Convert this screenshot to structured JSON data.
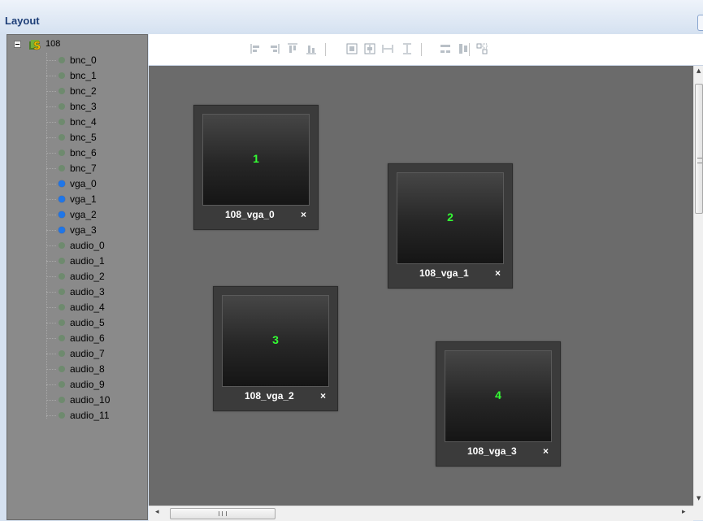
{
  "panel": {
    "title": "Layout"
  },
  "tree": {
    "root_label": "108",
    "items": [
      {
        "label": "bnc_0",
        "active": false
      },
      {
        "label": "bnc_1",
        "active": false
      },
      {
        "label": "bnc_2",
        "active": false
      },
      {
        "label": "bnc_3",
        "active": false
      },
      {
        "label": "bnc_4",
        "active": false
      },
      {
        "label": "bnc_5",
        "active": false
      },
      {
        "label": "bnc_6",
        "active": false
      },
      {
        "label": "bnc_7",
        "active": false
      },
      {
        "label": "vga_0",
        "active": true
      },
      {
        "label": "vga_1",
        "active": true
      },
      {
        "label": "vga_2",
        "active": true
      },
      {
        "label": "vga_3",
        "active": true
      },
      {
        "label": "audio_0",
        "active": false
      },
      {
        "label": "audio_1",
        "active": false
      },
      {
        "label": "audio_2",
        "active": false
      },
      {
        "label": "audio_3",
        "active": false
      },
      {
        "label": "audio_4",
        "active": false
      },
      {
        "label": "audio_5",
        "active": false
      },
      {
        "label": "audio_6",
        "active": false
      },
      {
        "label": "audio_7",
        "active": false
      },
      {
        "label": "audio_8",
        "active": false
      },
      {
        "label": "audio_9",
        "active": false
      },
      {
        "label": "audio_10",
        "active": false
      },
      {
        "label": "audio_11",
        "active": false
      }
    ]
  },
  "toolbar": {
    "buttons": [
      {
        "name": "align-left-icon"
      },
      {
        "name": "align-right-icon"
      },
      {
        "name": "align-top-icon"
      },
      {
        "name": "align-bottom-icon"
      },
      {
        "name": "center-vertical-icon"
      },
      {
        "name": "center-horizontal-icon"
      },
      {
        "name": "same-width-icon"
      },
      {
        "name": "same-height-icon"
      },
      {
        "name": "distribute-horizontal-icon"
      },
      {
        "name": "distribute-vertical-icon"
      },
      {
        "name": "same-size-icon"
      }
    ]
  },
  "windows": [
    {
      "number": "1",
      "label": "108_vga_0",
      "close": "×"
    },
    {
      "number": "2",
      "label": "108_vga_1",
      "close": "×"
    },
    {
      "number": "3",
      "label": "108_vga_2",
      "close": "×"
    },
    {
      "number": "4",
      "label": "108_vga_3",
      "close": "×"
    }
  ],
  "scrollbars": {
    "h_grip": "III"
  },
  "colors": {
    "accent_title": "#1e3f78",
    "active_dot": "#1f76e8",
    "inactive_dot": "#6e8a6e",
    "window_number": "#33ff33",
    "canvas": "#6b6b6b",
    "tree_background": "#8a8a8a"
  }
}
